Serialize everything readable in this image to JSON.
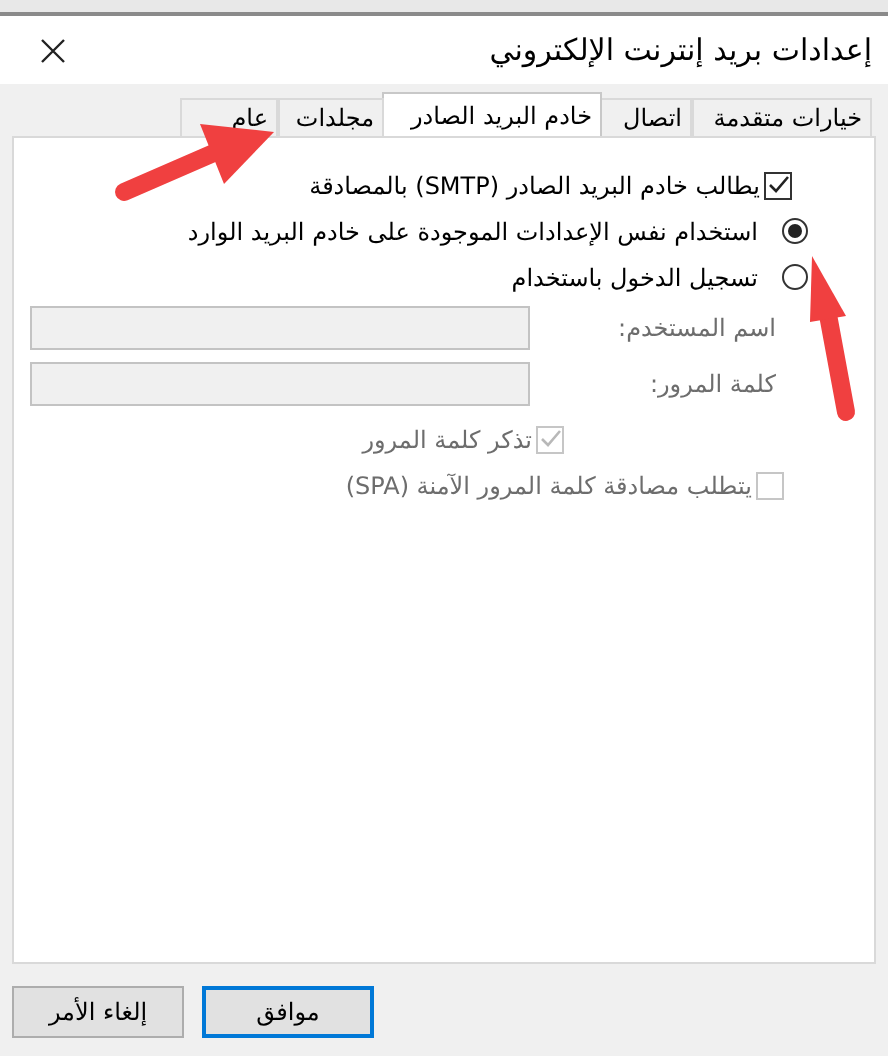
{
  "window": {
    "title": "إعدادات بريد إنترنت الإلكتروني"
  },
  "tabs": [
    {
      "label": "خيارات متقدمة",
      "selected": false
    },
    {
      "label": "اتصال",
      "selected": false
    },
    {
      "label": "خادم البريد الصادر",
      "selected": true
    },
    {
      "label": "مجلدات",
      "selected": false
    },
    {
      "label": "عام",
      "selected": false
    }
  ],
  "auth_check": {
    "label": "يطالب خادم البريد الصادر (SMTP) بالمصادقة",
    "checked": true
  },
  "radios": [
    {
      "label": "استخدام نفس الإعدادات الموجودة على خادم البريد الوارد",
      "selected": true
    },
    {
      "label": "تسجيل الدخول باستخدام",
      "selected": false
    }
  ],
  "fields": [
    {
      "label": "اسم المستخدم:",
      "disabled": true
    },
    {
      "label": "كلمة المرور:",
      "disabled": true
    }
  ],
  "sub_checks": [
    {
      "label": "تذكر كلمة المرور",
      "checked": true,
      "disabled": true
    },
    {
      "label": "يتطلب مصادقة كلمة المرور الآمنة (SPA)",
      "checked": false,
      "disabled": true
    }
  ],
  "buttons": [
    {
      "label": "موافق",
      "default": true
    },
    {
      "label": "إلغاء الأمر",
      "default": false
    }
  ]
}
